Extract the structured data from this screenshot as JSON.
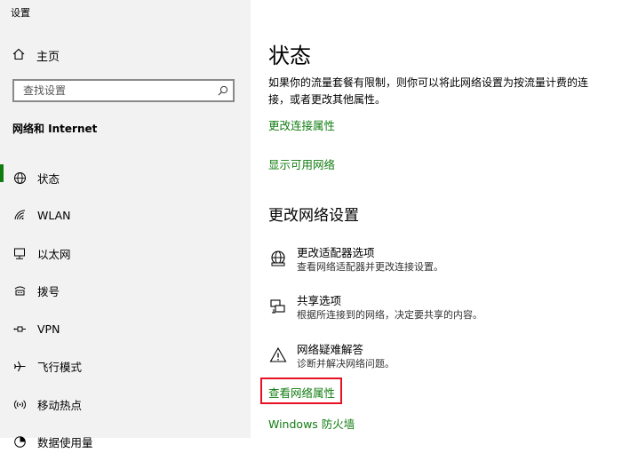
{
  "window": {
    "title": "设置"
  },
  "sidebar": {
    "home_label": "主页",
    "search_placeholder": "查找设置",
    "section_title": "网络和 Internet",
    "items": [
      {
        "label": "状态",
        "icon": "network-status-icon",
        "active": true
      },
      {
        "label": "WLAN",
        "icon": "wifi-icon"
      },
      {
        "label": "以太网",
        "icon": "ethernet-icon"
      },
      {
        "label": "拨号",
        "icon": "dialup-icon"
      },
      {
        "label": "VPN",
        "icon": "vpn-icon"
      },
      {
        "label": "飞行模式",
        "icon": "airplane-icon"
      },
      {
        "label": "移动热点",
        "icon": "hotspot-icon"
      },
      {
        "label": "数据使用量",
        "icon": "data-usage-icon"
      }
    ]
  },
  "main": {
    "title": "状态",
    "description": "如果你的流量套餐有限制，则你可以将此网络设置为按流量计费的连接，或者更改其他属性。",
    "links": {
      "change_connection_properties": "更改连接属性",
      "show_available_networks": "显示可用网络",
      "view_network_properties": "查看网络属性",
      "windows_firewall": "Windows 防火墙"
    },
    "change_settings_title": "更改网络设置",
    "options": [
      {
        "title": "更改适配器选项",
        "desc": "查看网络适配器并更改连接设置。",
        "icon": "adapter-globe-icon"
      },
      {
        "title": "共享选项",
        "desc": "根据所连接到的网络，决定要共享的内容。",
        "icon": "sharing-icon"
      },
      {
        "title": "网络疑难解答",
        "desc": "诊断并解决网络问题。",
        "icon": "warning-icon"
      }
    ]
  },
  "colors": {
    "accent": "#107c10",
    "highlight": "#e81123",
    "sidebar_bg": "#f2f2f2"
  }
}
